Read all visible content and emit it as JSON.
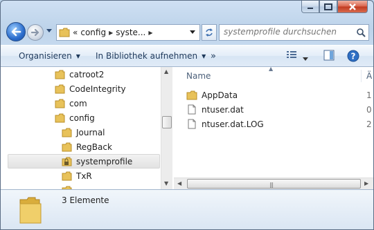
{
  "address_bar": {
    "overflow": "«",
    "crumbs": [
      "config",
      "syste..."
    ]
  },
  "search": {
    "placeholder": "systemprofile durchsuchen"
  },
  "toolbar": {
    "organize_label": "Organisieren",
    "include_label": "In Bibliothek aufnehmen",
    "more_label": "»"
  },
  "nav_pane": {
    "items": [
      {
        "label": "catroot2",
        "icon": "folder-icon",
        "level": 1
      },
      {
        "label": "CodeIntegrity",
        "icon": "folder-icon",
        "level": 1
      },
      {
        "label": "com",
        "icon": "folder-icon",
        "level": 1
      },
      {
        "label": "config",
        "icon": "folder-icon",
        "level": 1
      },
      {
        "label": "Journal",
        "icon": "folder-icon",
        "level": 2
      },
      {
        "label": "RegBack",
        "icon": "folder-icon",
        "level": 2
      },
      {
        "label": "systemprofile",
        "icon": "locked-folder-icon",
        "level": 2,
        "selected": true
      },
      {
        "label": "TxR",
        "icon": "folder-icon",
        "level": 2
      }
    ]
  },
  "file_list": {
    "column_name": "Name",
    "column_next_partial": "Ä",
    "rows": [
      {
        "name": "AppData",
        "icon": "folder-icon",
        "trail": "1"
      },
      {
        "name": "ntuser.dat",
        "icon": "file-icon",
        "trail": "0"
      },
      {
        "name": "ntuser.dat.LOG",
        "icon": "file-icon",
        "trail": "2"
      }
    ]
  },
  "details": {
    "item_count": "3 Elemente"
  },
  "colors": {
    "accent": "#2a6ccc",
    "close": "#c0391f",
    "folder": "#e8c25a"
  }
}
